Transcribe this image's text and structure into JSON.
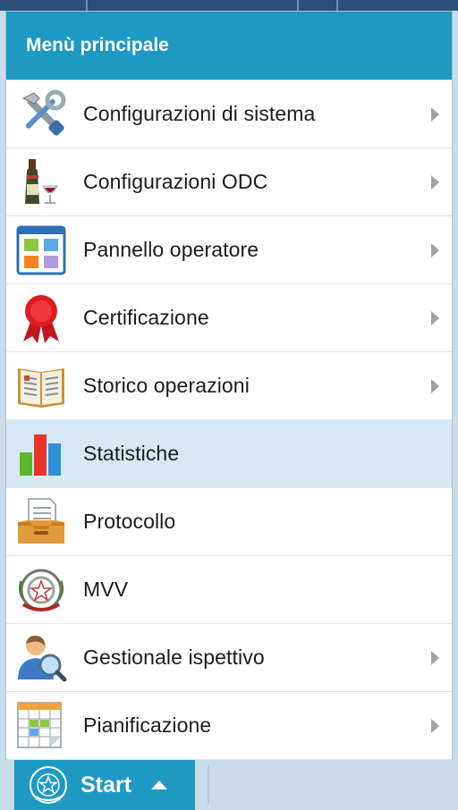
{
  "menu": {
    "title": "Menù principale",
    "items": [
      {
        "label": "Configurazioni di sistema",
        "icon": "tools-icon",
        "submenu": true
      },
      {
        "label": "Configurazioni ODC",
        "icon": "wine-bottle-icon",
        "submenu": true
      },
      {
        "label": "Pannello operatore",
        "icon": "dashboard-icon",
        "submenu": true
      },
      {
        "label": "Certificazione",
        "icon": "ribbon-badge-icon",
        "submenu": true
      },
      {
        "label": "Storico operazioni",
        "icon": "open-book-icon",
        "submenu": true
      },
      {
        "label": "Statistiche",
        "icon": "bar-chart-icon",
        "submenu": false,
        "selected": true
      },
      {
        "label": "Protocollo",
        "icon": "document-tray-icon",
        "submenu": false
      },
      {
        "label": "MVV",
        "icon": "emblem-icon",
        "submenu": false
      },
      {
        "label": "Gestionale ispettivo",
        "icon": "user-search-icon",
        "submenu": true
      },
      {
        "label": "Pianificazione",
        "icon": "calendar-icon",
        "submenu": true
      }
    ]
  },
  "taskbar": {
    "start_label": "Start",
    "start_icon": "emblem-icon"
  },
  "colors": {
    "accent": "#1e99c4",
    "selected_row": "#d4e9f1",
    "background": "#c9dde8"
  }
}
